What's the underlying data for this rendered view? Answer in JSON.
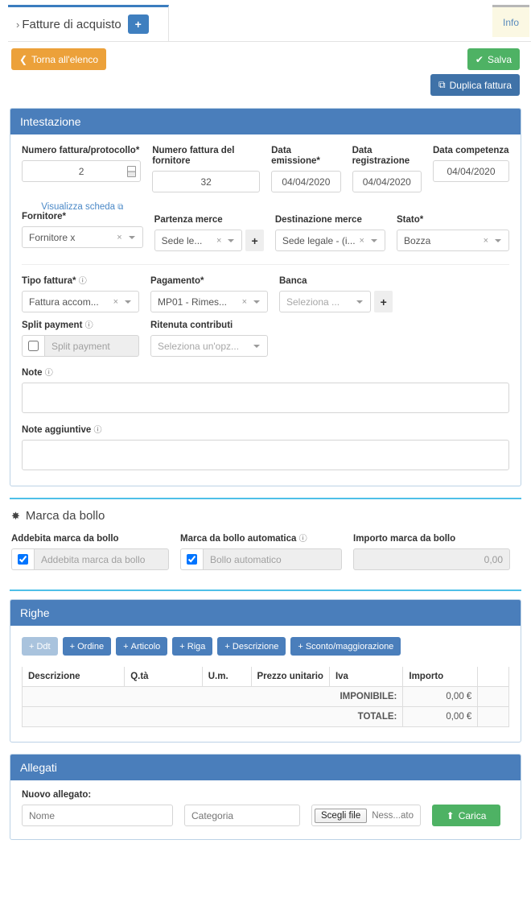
{
  "tabs": {
    "caret": "›",
    "main_label": "Fatture di acquisto",
    "plus_label": "+",
    "info_label": "Info"
  },
  "actions": {
    "back_label": "Torna all'elenco",
    "back_icon": "❮",
    "save_label": "Salva",
    "save_icon": "✔",
    "duplicate_label": "Duplica fattura",
    "duplicate_icon": "⧉"
  },
  "intestazione": {
    "title": "Intestazione",
    "numero_protocollo": {
      "label": "Numero fattura/protocollo*",
      "value": "2"
    },
    "numero_fornitore": {
      "label": "Numero fattura del fornitore",
      "value": "32"
    },
    "data_emissione": {
      "label": "Data emissione*",
      "value": "04/04/2020"
    },
    "data_registrazione": {
      "label": "Data registrazione",
      "value": "04/04/2020"
    },
    "data_competenza": {
      "label": "Data competenza",
      "value": "04/04/2020"
    },
    "visualizza_scheda": {
      "label": "Visualizza scheda",
      "icon": "⧉"
    },
    "fornitore": {
      "label": "Fornitore*",
      "value": "Fornitore x"
    },
    "partenza_merce": {
      "label": "Partenza merce",
      "value": "Sede le...",
      "add_label": "+"
    },
    "destinazione_merce": {
      "label": "Destinazione merce",
      "value": "Sede legale - (i..."
    },
    "stato": {
      "label": "Stato*",
      "value": "Bozza"
    },
    "tipo_fattura": {
      "label": "Tipo fattura*",
      "help": "ⓘ",
      "value": "Fattura accom..."
    },
    "pagamento": {
      "label": "Pagamento*",
      "value": "MP01 - Rimes..."
    },
    "banca": {
      "label": "Banca",
      "placeholder": "Seleziona ...",
      "add_label": "+"
    },
    "split_payment": {
      "label": "Split payment",
      "help": "ⓘ",
      "placeholder": "Split payment",
      "checked": false
    },
    "ritenuta": {
      "label": "Ritenuta contributi",
      "placeholder": "Seleziona un'opz..."
    },
    "note": {
      "label": "Note",
      "help": "ⓘ",
      "value": ""
    },
    "note_aggiuntive": {
      "label": "Note aggiuntive",
      "help": "ⓘ",
      "value": ""
    }
  },
  "marca_da_bollo": {
    "title": "Marca da bollo",
    "icon": "✸",
    "addebita": {
      "label": "Addebita marca da bollo",
      "placeholder": "Addebita marca da bollo",
      "checked": true
    },
    "automatica": {
      "label": "Marca da bollo automatica",
      "help": "ⓘ",
      "placeholder": "Bollo automatico",
      "checked": true
    },
    "importo": {
      "label": "Importo marca da bollo",
      "value": "0,00"
    }
  },
  "righe": {
    "title": "Righe",
    "buttons": [
      {
        "label": "Ddt",
        "disabled": true
      },
      {
        "label": "Ordine",
        "disabled": false
      },
      {
        "label": "Articolo",
        "disabled": false
      },
      {
        "label": "Riga",
        "disabled": false
      },
      {
        "label": "Descrizione",
        "disabled": false
      },
      {
        "label": "Sconto/maggiorazione",
        "disabled": false
      }
    ],
    "plus": "+",
    "columns": [
      "Descrizione",
      "Q.tà",
      "U.m.",
      "Prezzo unitario",
      "Iva",
      "Importo",
      ""
    ],
    "summary": [
      {
        "label": "IMPONIBILE:",
        "value": "0,00 €"
      },
      {
        "label": "TOTALE:",
        "value": "0,00 €"
      }
    ]
  },
  "allegati": {
    "title": "Allegati",
    "new_label": "Nuovo allegato:",
    "nome_placeholder": "Nome",
    "categoria_placeholder": "Categoria",
    "file_button": "Scegli file",
    "file_name": "Ness...ato",
    "upload_label": "Carica",
    "upload_icon": "⬆"
  },
  "colors": {
    "panel_header": "#4a7ebb",
    "accent_blue": "#3f7fbf",
    "orange": "#eca13a",
    "green": "#4eb264",
    "cyan_rule": "#4ec0e8"
  }
}
